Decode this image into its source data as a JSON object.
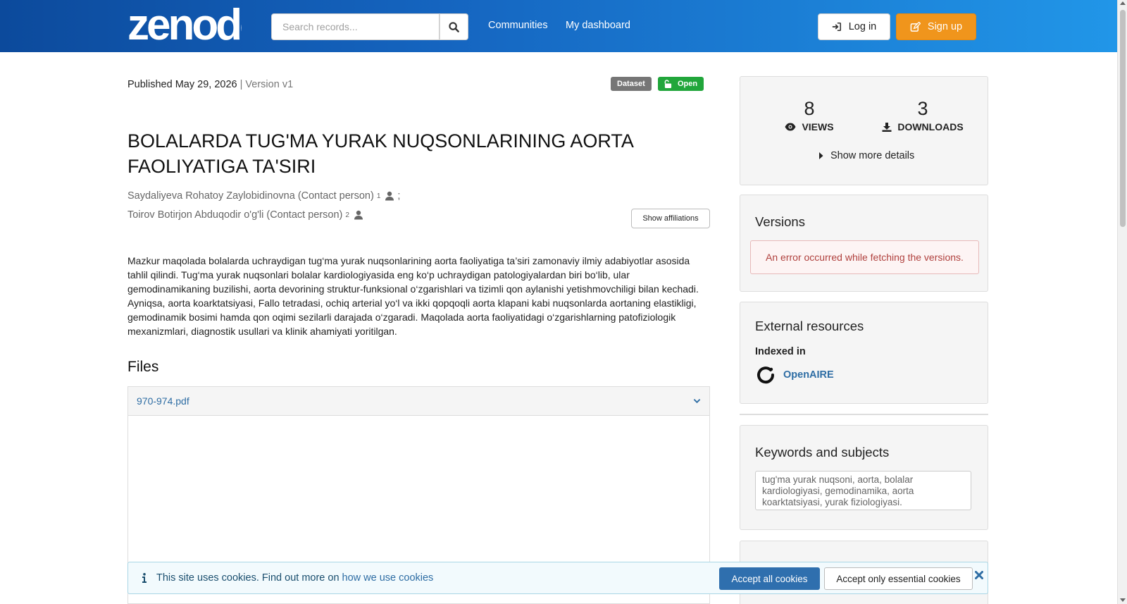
{
  "header": {
    "logo_text": "zenodo",
    "search_placeholder": "Search records...",
    "nav": [
      "Communities",
      "My dashboard"
    ],
    "login_label": "Log in",
    "signup_label": "Sign up"
  },
  "record": {
    "published_label": "Published",
    "published_date": "May 29, 2026",
    "version_text": "| Version v1",
    "badge_type": "Dataset",
    "badge_access": "Open",
    "title": "BOLALARDA TUG'MA YURAK NUQSONLARINING AORTA FAOLIYATIGA TA'SIRI",
    "authors": [
      {
        "name": "Saydaliyeva Rohatoy Zaylobidinovna (Contact person)",
        "aff": "1",
        "sep": ";"
      },
      {
        "name": "Toirov Botirjon Abduqodir o'g'li (Contact person)",
        "aff": "2",
        "sep": ""
      }
    ],
    "show_affiliations": "Show affiliations",
    "abstract": "Mazkur maqolada bolalarda uchraydigan tug‘ma yurak nuqsonlarining aorta faoliyatiga ta’siri zamonaviy ilmiy adabiyotlar asosida tahlil qilindi. Tug‘ma yurak nuqsonlari bolalar kardiologiyasida eng ko‘p uchraydigan patologiyalardan biri bo‘lib, ular gemodinamikaning buzilishi, aorta devorining struktur-funksional o‘zgarishlari va tizimli qon aylanishi yetishmovchiligi bilan kechadi. Ayniqsa, aorta koarktatsiyasi, Fallo tetradasi, ochiq arterial yo‘l va ikki qopqoqli aorta klapani kabi nuqsonlarda aortaning elastikligi, gemodinamik bosimi hamda qon oqimi sezilarli darajada o‘zgaradi. Maqolada aorta faoliyatidagi o‘zgarishlarning patofiziologik mexanizmlari, diagnostik usullari va klinik ahamiyati yoritilgan.",
    "files_heading": "Files",
    "file_name": "970-974.pdf"
  },
  "sidebar": {
    "views": "8",
    "views_label": "VIEWS",
    "downloads": "3",
    "downloads_label": "DOWNLOADS",
    "show_more": "Show more details",
    "versions_heading": "Versions",
    "versions_error": "An error occurred while fetching the versions.",
    "external_heading": "External resources",
    "indexed_in": "Indexed in",
    "openaire": "OpenAIRE",
    "keywords_heading": "Keywords and subjects",
    "keywords": "tug'ma yurak nuqsoni, aorta, bolalar kardiologiyasi, gemodinamika, aorta koarktatsiyasi, yurak fiziologiyasi."
  },
  "cookie": {
    "text": "This site uses cookies. Find out more on",
    "link": "how we use cookies",
    "accept_all": "Accept all cookies",
    "accept_essential": "Accept only essential cookies"
  },
  "colors": {
    "header_start": "#0c4a9c",
    "header_end": "#2196e8",
    "signup": "#f0951c",
    "open_badge": "#21a63b",
    "link": "#2e6da4"
  }
}
